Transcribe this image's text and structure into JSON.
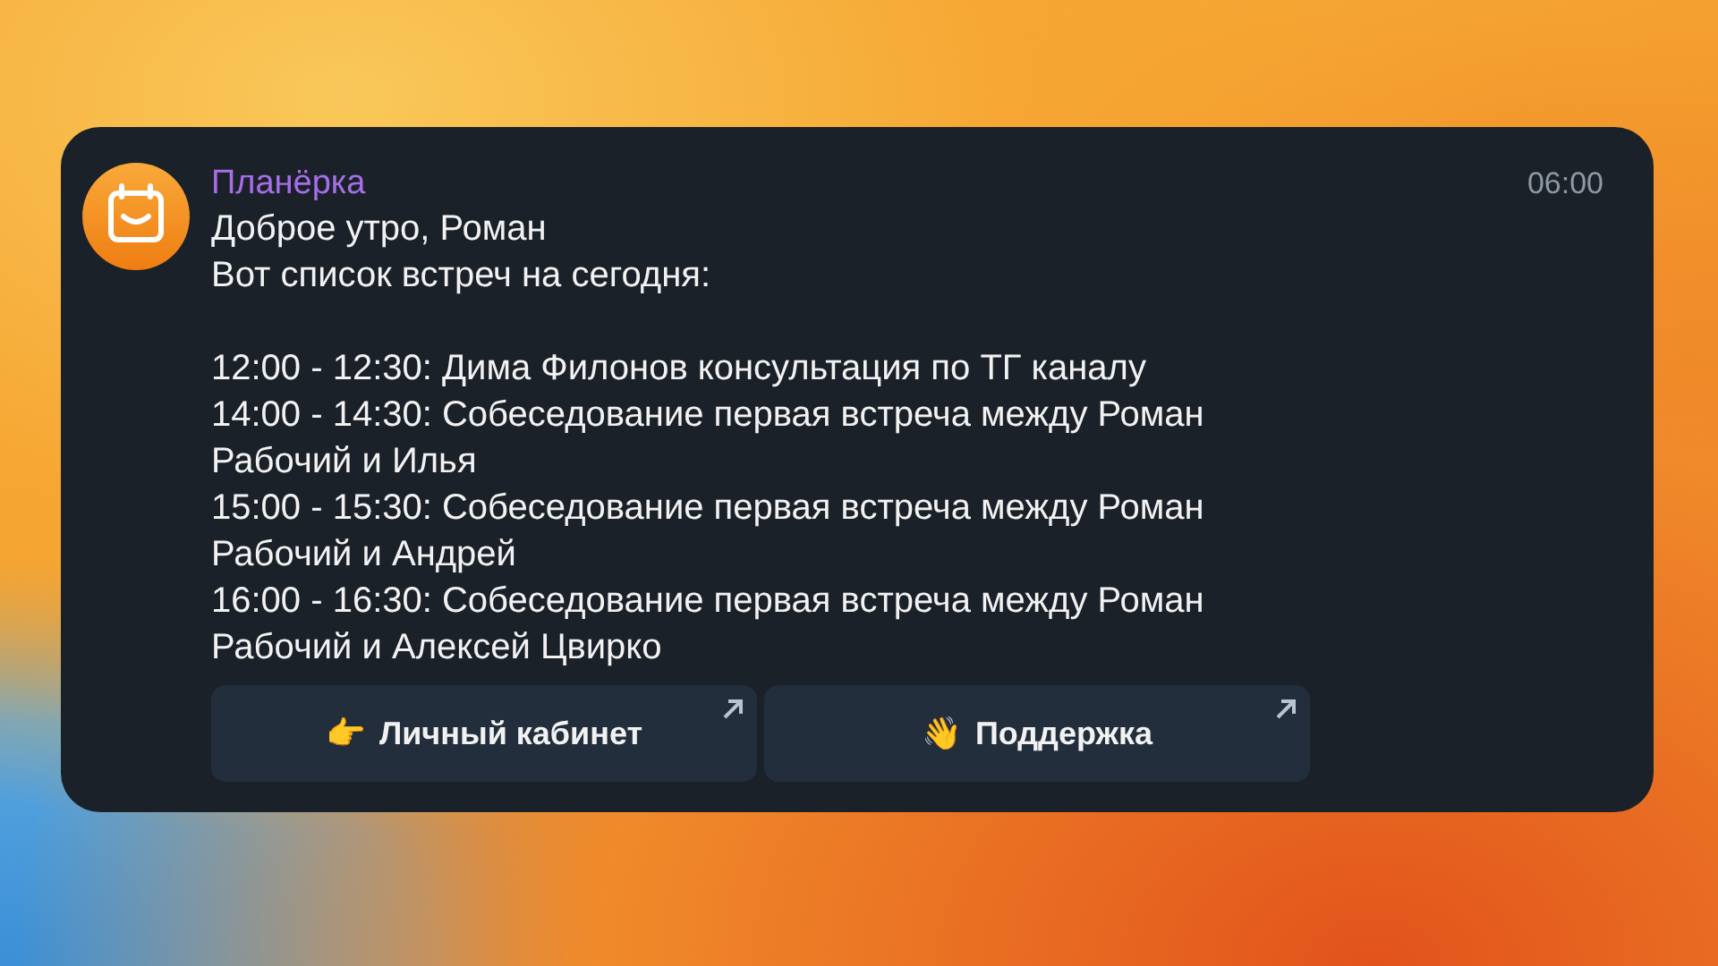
{
  "notification": {
    "app": "Планёрка",
    "time": "06:00",
    "greeting": "Доброе утро, Роман",
    "intro": "Вот список встреч на сегодня:",
    "meetings": [
      "12:00 - 12:30: Дима Филонов консультация по ТГ каналу",
      "14:00 - 14:30: Собеседование первая встреча между Роман Рабочий и Илья",
      "15:00 - 15:30: Собеседование первая встреча между Роман Рабочий и Андрей",
      "16:00 - 16:30: Собеседование первая встреча между Роман Рабочий и Алексей Цвирко"
    ],
    "buttons": [
      {
        "emoji": "👉",
        "label": "Личный кабинет"
      },
      {
        "emoji": "👋",
        "label": "Поддержка"
      }
    ]
  }
}
